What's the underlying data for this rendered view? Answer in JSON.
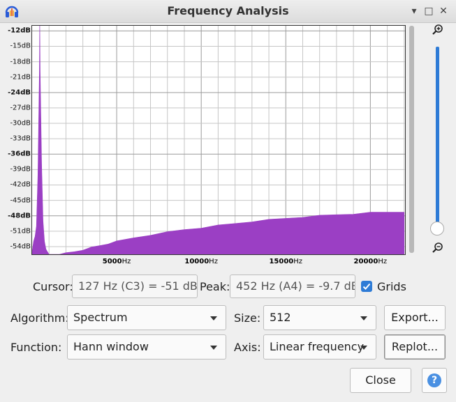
{
  "window": {
    "title": "Frequency Analysis",
    "icon": "audacity-headphones-icon"
  },
  "controls": {
    "minimize": "▾",
    "maximize": "□",
    "close": "✕"
  },
  "chart_data": {
    "type": "area",
    "title": "",
    "xlabel": "",
    "ylabel": "",
    "xlim": [
      0,
      22050
    ],
    "ylim": [
      -55.5,
      -11
    ],
    "grid": true,
    "y_ticks": [
      {
        "label": "-12dB",
        "value": -12,
        "bold": true
      },
      {
        "label": "-15dB",
        "value": -15,
        "bold": false
      },
      {
        "label": "-18dB",
        "value": -18,
        "bold": false
      },
      {
        "label": "-21dB",
        "value": -21,
        "bold": false
      },
      {
        "label": "-24dB",
        "value": -24,
        "bold": true
      },
      {
        "label": "-27dB",
        "value": -27,
        "bold": false
      },
      {
        "label": "-30dB",
        "value": -30,
        "bold": false
      },
      {
        "label": "-33dB",
        "value": -33,
        "bold": false
      },
      {
        "label": "-36dB",
        "value": -36,
        "bold": true
      },
      {
        "label": "-39dB",
        "value": -39,
        "bold": false
      },
      {
        "label": "-42dB",
        "value": -42,
        "bold": false
      },
      {
        "label": "-45dB",
        "value": -45,
        "bold": false
      },
      {
        "label": "-48dB",
        "value": -48,
        "bold": true
      },
      {
        "label": "-51dB",
        "value": -51,
        "bold": false
      },
      {
        "label": "-54dB",
        "value": -54,
        "bold": false
      }
    ],
    "x_ticks": [
      {
        "value": 5000,
        "num": "5000",
        "unit": "Hz"
      },
      {
        "value": 10000,
        "num": "10000",
        "unit": "Hz"
      },
      {
        "value": 15000,
        "num": "15000",
        "unit": "Hz"
      },
      {
        "value": 20000,
        "num": "20000",
        "unit": "Hz"
      }
    ],
    "series": [
      {
        "color": "#9b3fc4",
        "x": [
          0,
          86,
          172,
          258,
          344,
          430,
          452,
          474,
          560,
          646,
          732,
          818,
          904,
          1000,
          1500,
          2000,
          2500,
          3000,
          3500,
          4000,
          4500,
          5000,
          6000,
          7000,
          8000,
          9000,
          10000,
          11000,
          12000,
          13000,
          14000,
          15000,
          16000,
          17000,
          18000,
          19000,
          20000,
          21000,
          22000
        ],
        "y": [
          -55,
          -53,
          -52,
          -50,
          -40,
          -20,
          -9.7,
          -20,
          -38,
          -49,
          -53,
          -54.5,
          -55,
          -55.5,
          -55.5,
          -55.3,
          -55,
          -54.6,
          -54.2,
          -53.8,
          -53.4,
          -53,
          -52.3,
          -51.7,
          -51.2,
          -50.7,
          -50.3,
          -49.9,
          -49.5,
          -49.1,
          -48.8,
          -48.5,
          -48.2,
          -48,
          -47.8,
          -47.6,
          -47.4,
          -47.3,
          -47.2
        ]
      }
    ]
  },
  "cursor": {
    "label": "Cursor:",
    "value": "127 Hz (C3) = -51 dB"
  },
  "peak": {
    "label": "Peak:",
    "value": "452 Hz (A4) = -9.7 dB"
  },
  "grids": {
    "label": "Grids",
    "checked": true
  },
  "algorithm": {
    "label": "Algorithm:",
    "value": "Spectrum"
  },
  "size": {
    "label": "Size:",
    "value": "512"
  },
  "function": {
    "label": "Function:",
    "value": "Hann window"
  },
  "axis": {
    "label": "Axis:",
    "value": "Linear frequency"
  },
  "buttons": {
    "export": "Export...",
    "replot": "Replot...",
    "close": "Close",
    "help": "?"
  }
}
